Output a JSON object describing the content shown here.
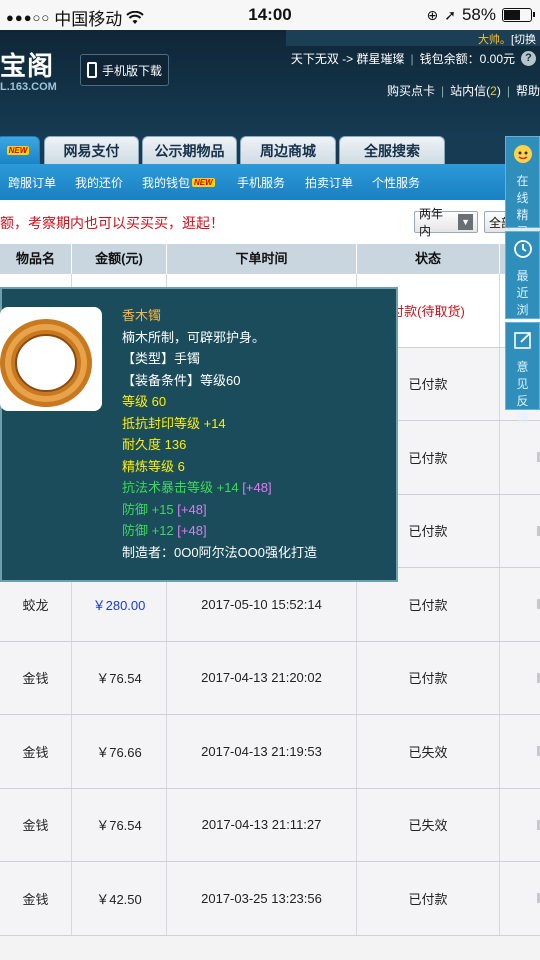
{
  "status_bar": {
    "signal": "●●●○○",
    "carrier": "中国移动",
    "wifi_icon": "wifi-icon",
    "time": "14:00",
    "battery_percent": "58%",
    "battery_level": 0.58
  },
  "header": {
    "logo_text": "宝阁",
    "logo_domain": "L.163.COM",
    "mobile_download": "手机版下载",
    "user_greeting": "大帅。",
    "user_switch": "[切换",
    "server_path": "天下无双 -> 群星璀璨",
    "wallet_label": "钱包余额：",
    "wallet_value": "0.00元",
    "help_glyph": "?",
    "link_buy_card": "购买点卡",
    "link_inbox": "站内信(",
    "inbox_count": "2",
    "inbox_close": ")",
    "link_help": "帮助"
  },
  "tabs": {
    "first_badge": "NEW",
    "items": [
      "网易支付",
      "公示期物品",
      "周边商城",
      "全服搜索"
    ]
  },
  "subnav": {
    "items": [
      "跨服订单",
      "我的还价",
      "我的钱包",
      "手机服务",
      "拍卖订单",
      "个性服务"
    ],
    "wallet_badge": "NEW"
  },
  "notice": {
    "text": "额，考察期内也可以买买买，逛起！",
    "filter_selected": "两年内",
    "filter2_selected": "全部"
  },
  "table": {
    "headers": [
      "物品名",
      "金额(元)",
      "下单时间",
      "状态"
    ],
    "first_row_status": "付款(待取货)",
    "rows": [
      {
        "name": "",
        "amount": "",
        "time": "",
        "status": "已付款"
      },
      {
        "name": "",
        "amount": "",
        "time": "",
        "status": "已付款"
      },
      {
        "name": "",
        "amount": "",
        "time": "",
        "status": "已付款"
      },
      {
        "name": "蛟龙",
        "amount": "￥280.00",
        "time": "2017-05-10 15:52:14",
        "status": "已付款"
      },
      {
        "name": "金钱",
        "amount": "￥76.54",
        "time": "2017-04-13 21:20:02",
        "status": "已付款"
      },
      {
        "name": "金钱",
        "amount": "￥76.66",
        "time": "2017-04-13 21:19:53",
        "status": "已失效"
      },
      {
        "name": "金钱",
        "amount": "￥76.54",
        "time": "2017-04-13 21:11:27",
        "status": "已失效"
      },
      {
        "name": "金钱",
        "amount": "￥42.50",
        "time": "2017-03-25 13:23:56",
        "status": "已付款"
      }
    ]
  },
  "tooltip": {
    "name": "香木镯",
    "desc": "楠木所制，可辟邪护身。",
    "type": "【类型】手镯",
    "requirement": "【装备条件】等级60",
    "level": "等级 60",
    "stat1": "抵抗封印等级 +14",
    "durability": "耐久度 136",
    "refine": "精炼等级 6",
    "stat2": "抗法术暴击等级 +14",
    "stat2_bonus": "[+48]",
    "stat3": "防御 +15",
    "stat3_bonus": "[+48]",
    "stat4": "防御 +12",
    "stat4_bonus": "[+48]",
    "maker": "制造者：0O0阿尔法OO0强化打造"
  },
  "side_panel": {
    "online": "在线精灵",
    "recent": "最近浏览",
    "feedback": "意见反馈"
  }
}
